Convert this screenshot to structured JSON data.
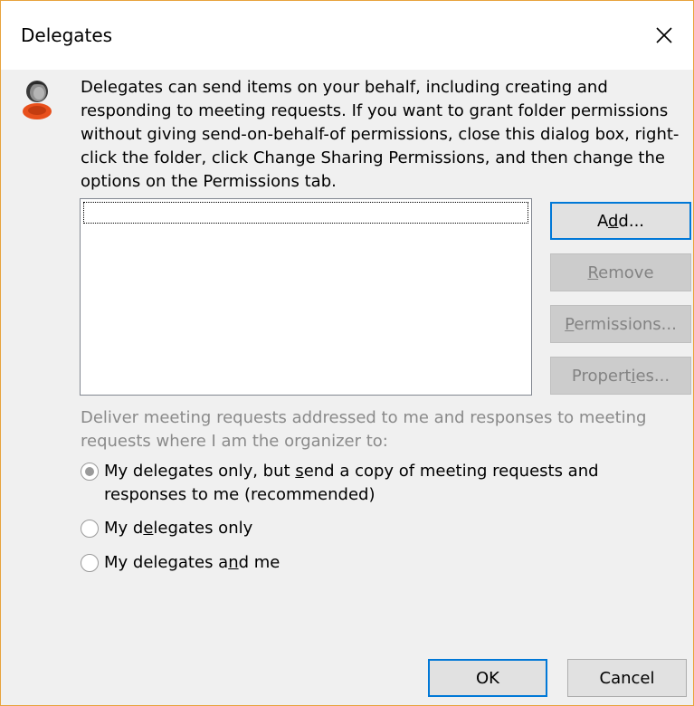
{
  "window": {
    "title": "Delegates"
  },
  "info": {
    "text": "Delegates can send items on your behalf, including creating and responding to meeting requests. If you want to grant folder permissions without giving send-on-behalf-of permissions, close this dialog box, right-click the folder, click Change Sharing Permissions, and then change the options on the Permissions tab."
  },
  "buttons": {
    "add": {
      "pre": "A",
      "key": "d",
      "post": "d..."
    },
    "remove": {
      "pre": "",
      "key": "R",
      "post": "emove"
    },
    "permissions": {
      "pre": "",
      "key": "P",
      "post": "ermissions..."
    },
    "properties": {
      "pre": "Propert",
      "key": "i",
      "post": "es..."
    }
  },
  "delivery": {
    "label": "Deliver meeting requests addressed to me and responses to meeting requests where I am the organizer to:",
    "options": [
      {
        "pre": "My delegates only, but ",
        "key": "s",
        "post": "end a copy of meeting requests and responses to me (recommended)",
        "checked": true
      },
      {
        "pre": "My d",
        "key": "e",
        "post": "legates only",
        "checked": false
      },
      {
        "pre": "My delegates a",
        "key": "n",
        "post": "d me",
        "checked": false
      }
    ]
  },
  "footer": {
    "ok": "OK",
    "cancel": "Cancel"
  },
  "colors": {
    "accent": "#0078d7",
    "icon_orange": "#e8501c",
    "frame": "#e8a33d"
  },
  "icons": {
    "close": "close-icon",
    "delegate": "delegate-person-icon"
  }
}
